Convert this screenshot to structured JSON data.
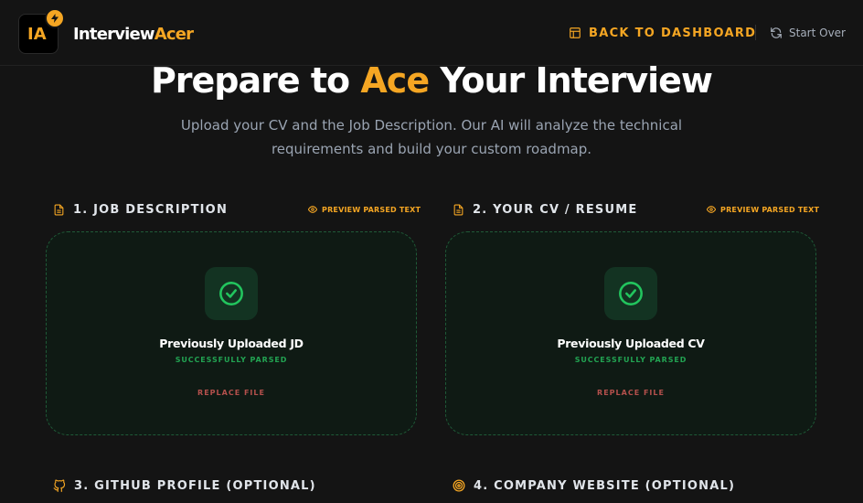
{
  "header": {
    "logo_text": "IA",
    "brand_part1": "Interview",
    "brand_part2": "Acer",
    "back_label": "BACK TO DASHBOARD",
    "start_over_label": "Start Over"
  },
  "hero": {
    "title_pre": "Prepare to ",
    "title_accent": "Ace",
    "title_post": " Your Interview",
    "subtitle": "Upload your CV and the Job Description. Our AI will analyze the technical requirements and build your custom roadmap."
  },
  "sections": {
    "jd": {
      "heading": "1. JOB DESCRIPTION",
      "preview_label": "PREVIEW PARSED TEXT",
      "card_title": "Previously Uploaded JD",
      "status": "SUCCESSFULLY PARSED",
      "replace_label": "REPLACE FILE"
    },
    "cv": {
      "heading": "2. YOUR CV / RESUME",
      "preview_label": "PREVIEW PARSED TEXT",
      "card_title": "Previously Uploaded CV",
      "status": "SUCCESSFULLY PARSED",
      "replace_label": "REPLACE FILE"
    },
    "github": {
      "heading": "3. GITHUB PROFILE (OPTIONAL)"
    },
    "company": {
      "heading": "4. COMPANY WEBSITE (OPTIONAL)"
    }
  },
  "colors": {
    "accent": "#f5a623",
    "success": "#22a352",
    "danger": "#b4504c",
    "background": "#141414"
  },
  "icons": {
    "logo_badge": "bolt-icon",
    "back": "layout-icon",
    "start_over": "refresh-icon",
    "section_file": "file-text-icon",
    "preview": "eye-icon",
    "uploaded": "check-circle-icon",
    "github": "github-icon",
    "website": "target-icon"
  }
}
